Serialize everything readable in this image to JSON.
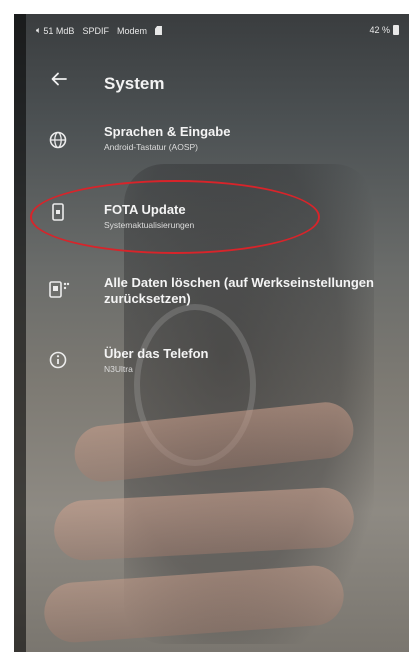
{
  "status_bar": {
    "left_text": "51 MdB",
    "spdif": "SPDIF",
    "mode": "Modem",
    "battery": "42 %"
  },
  "app_bar": {
    "title": "System",
    "back_icon": "arrow-back-icon"
  },
  "settings": [
    {
      "icon": "globe-icon",
      "title": "Sprachen & Eingabe",
      "subtitle": "Android-Tastatur (AOSP)"
    },
    {
      "icon": "system-update-icon",
      "title": "FOTA Update",
      "subtitle": "Systemaktualisierungen"
    },
    {
      "icon": "reset-phone-icon",
      "title": "Alle Daten löschen (auf Werkseinstellungen zurücksetzen)",
      "subtitle": ""
    },
    {
      "icon": "info-icon",
      "title": "Über das Telefon",
      "subtitle": "N3Ultra"
    }
  ],
  "annotation": {
    "highlight_color": "#d8242a",
    "highlighted_item": "FOTA Update"
  }
}
